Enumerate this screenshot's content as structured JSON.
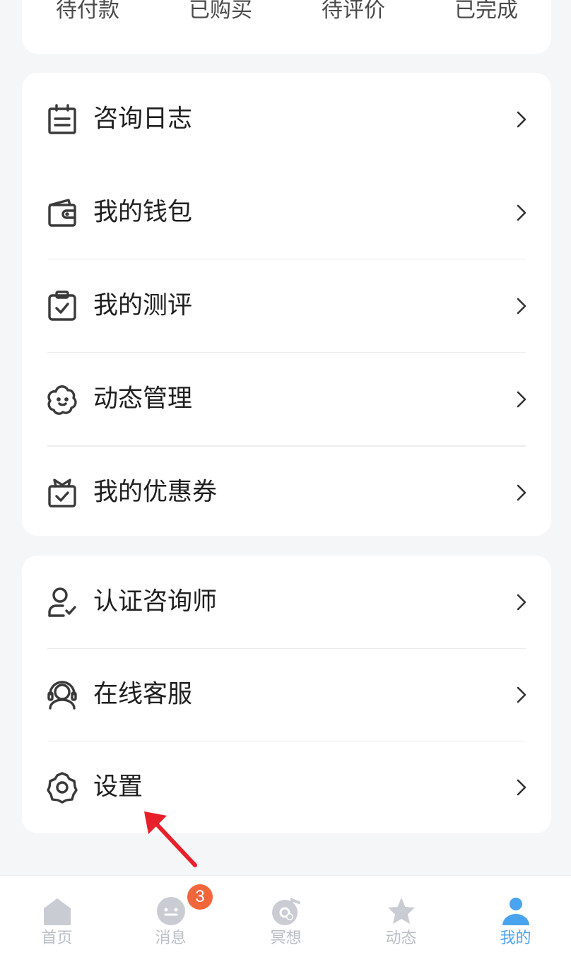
{
  "order_tabs": [
    "待付款",
    "已购买",
    "待评价",
    "已完成"
  ],
  "menu_group_1": [
    {
      "label": "咨询日志",
      "icon": "calendar-icon"
    },
    {
      "label": "我的钱包",
      "icon": "wallet-icon"
    },
    {
      "label": "我的测评",
      "icon": "clipboard-check-icon"
    },
    {
      "label": "动态管理",
      "icon": "cloud-face-icon"
    },
    {
      "label": "我的优惠券",
      "icon": "gift-box-icon"
    }
  ],
  "menu_group_2": [
    {
      "label": "认证咨询师",
      "icon": "user-check-icon"
    },
    {
      "label": "在线客服",
      "icon": "headset-icon"
    },
    {
      "label": "设置",
      "icon": "gear-icon"
    }
  ],
  "bottom_nav": {
    "items": [
      {
        "label": "首页",
        "icon": "home-icon",
        "active": false
      },
      {
        "label": "消息",
        "icon": "chat-icon",
        "active": false,
        "badge": "3"
      },
      {
        "label": "冥想",
        "icon": "music-disc-icon",
        "active": false
      },
      {
        "label": "动态",
        "icon": "star-icon",
        "active": false
      },
      {
        "label": "我的",
        "icon": "user-icon",
        "active": true
      }
    ]
  },
  "colors": {
    "background": "#f5f6f8",
    "card": "#ffffff",
    "text": "#1f1f1f",
    "icon": "#3a3a3a",
    "nav_inactive": "#b9bec6",
    "nav_active": "#4aa3ee",
    "badge": "#f2663c",
    "annotation_arrow": "#e8202a"
  }
}
